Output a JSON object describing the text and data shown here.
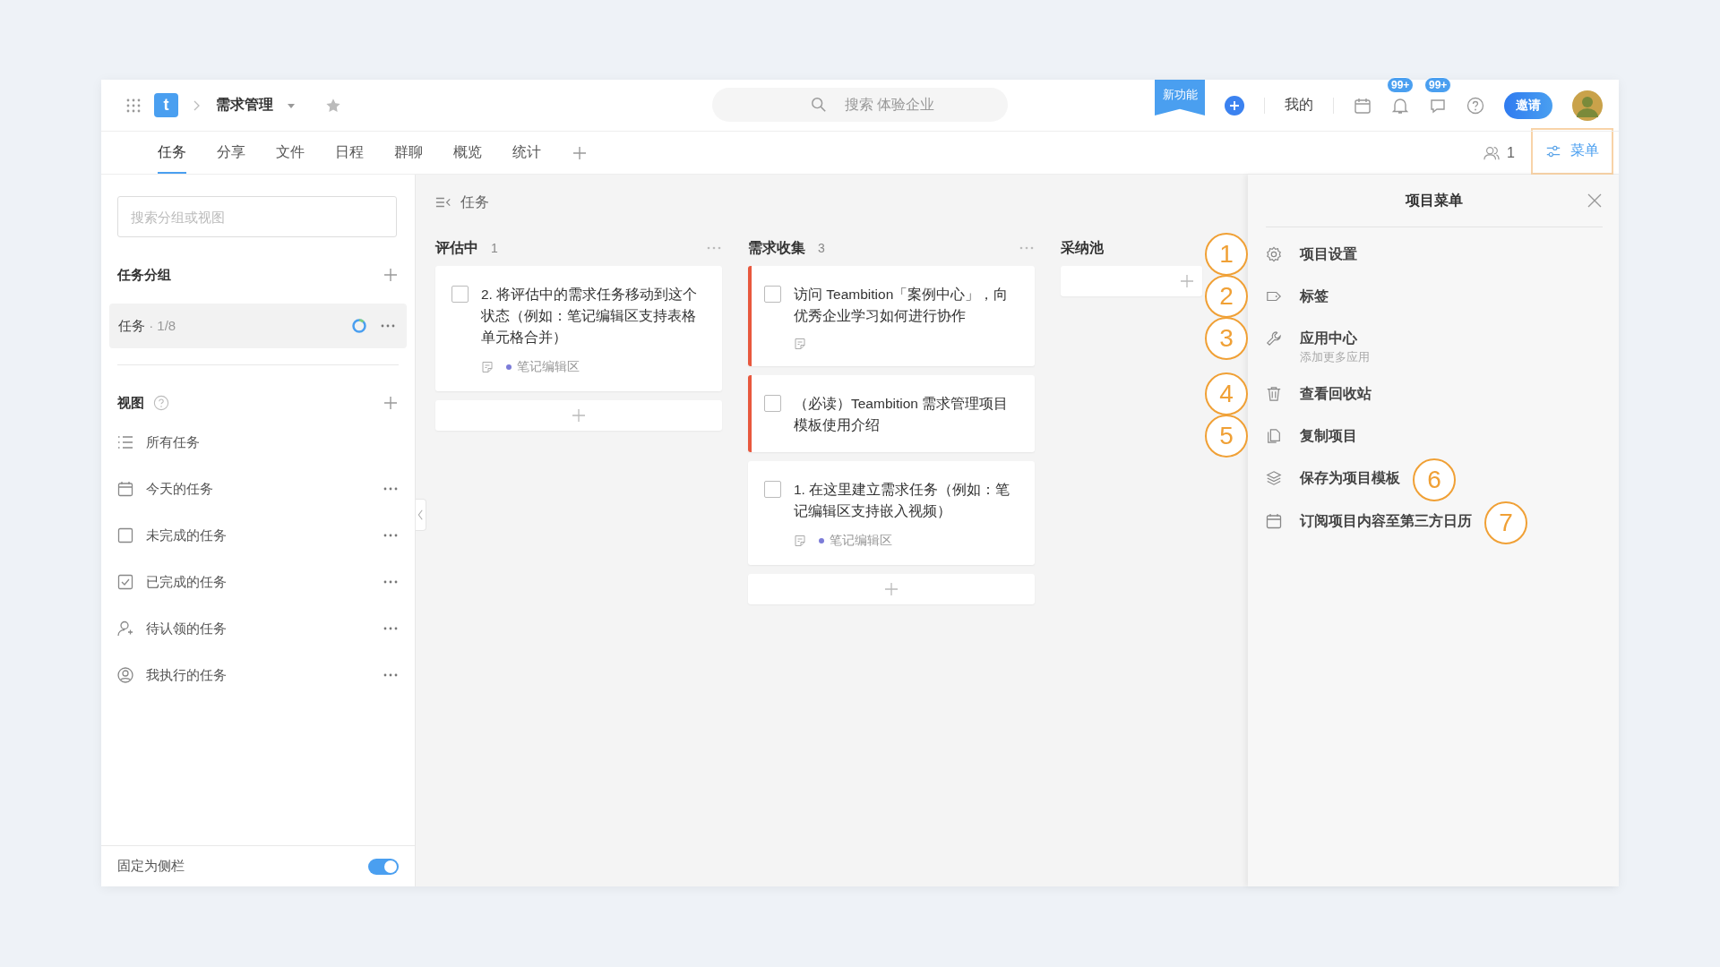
{
  "topbar": {
    "logo": "t",
    "project": "需求管理",
    "search_placeholder": "搜索 体验企业",
    "new_feature": "新功能",
    "mine": "我的",
    "badges": [
      "99+",
      "99+"
    ],
    "invite": "邀请"
  },
  "tabs": [
    {
      "label": "任务",
      "selected": true
    },
    {
      "label": "分享",
      "selected": false
    },
    {
      "label": "文件",
      "selected": false
    },
    {
      "label": "日程",
      "selected": false
    },
    {
      "label": "群聊",
      "selected": false
    },
    {
      "label": "概览",
      "selected": false
    },
    {
      "label": "统计",
      "selected": false
    }
  ],
  "members_count": "1",
  "menu_button": "菜单",
  "sidebar": {
    "search_placeholder": "搜索分组或视图",
    "groups_title": "任务分组",
    "groups": [
      {
        "label": "任务",
        "count": "· 1/8",
        "selected": true
      }
    ],
    "views_title": "视图",
    "views": [
      {
        "kind": "list",
        "label": "所有任务",
        "more": false
      },
      {
        "kind": "calendar",
        "label": "今天的任务",
        "more": true
      },
      {
        "kind": "box",
        "label": "未完成的任务",
        "more": true
      },
      {
        "kind": "checked",
        "label": "已完成的任务",
        "more": true
      },
      {
        "kind": "person-add",
        "label": "待认领的任务",
        "more": true
      },
      {
        "kind": "person",
        "label": "我执行的任务",
        "more": true
      }
    ],
    "pin_label": "固定为侧栏",
    "pin_on": true
  },
  "board": {
    "title": "任务",
    "columns": [
      {
        "name": "评估中",
        "count": "1",
        "cards": [
          {
            "text": "2. 将评估中的需求任务移动到这个状态（例如：笔记编辑区支持表格单元格合并）",
            "priority": false,
            "note": true,
            "tag": "笔记编辑区"
          }
        ]
      },
      {
        "name": "需求收集",
        "count": "3",
        "cards": [
          {
            "text": "访问 Teambition「案例中心」，向优秀企业学习如何进行协作",
            "priority": true,
            "note": true
          },
          {
            "text": "（必读）Teambition 需求管理项目模板使用介绍",
            "priority": true,
            "note": false
          },
          {
            "text": "1. 在这里建立需求任务（例如：笔记编辑区支持嵌入视频）",
            "priority": false,
            "note": true,
            "tag": "笔记编辑区"
          }
        ]
      },
      {
        "name": "采纳池"
      }
    ]
  },
  "panel": {
    "title": "项目菜单",
    "items": [
      {
        "kind": "gear",
        "label": "项目设置",
        "annotation": {
          "kind": "left",
          "number": "1"
        }
      },
      {
        "kind": "tag",
        "label": "标签",
        "annotation": {
          "kind": "left",
          "number": "2"
        }
      },
      {
        "kind": "wrench",
        "label": "应用中心",
        "sub": "添加更多应用",
        "annotation": {
          "kind": "left",
          "number": "3"
        }
      },
      {
        "kind": "trash",
        "label": "查看回收站",
        "annotation": {
          "kind": "left",
          "number": "4"
        }
      },
      {
        "kind": "copy",
        "label": "复制项目",
        "annotation": {
          "kind": "left",
          "number": "5"
        }
      },
      {
        "kind": "layers",
        "label": "保存为项目模板",
        "annotation": {
          "kind": "after",
          "number": "6"
        }
      },
      {
        "kind": "calendar",
        "label": "订阅项目内容至第三方日历",
        "annotation": {
          "kind": "after",
          "number": "7"
        }
      }
    ]
  }
}
